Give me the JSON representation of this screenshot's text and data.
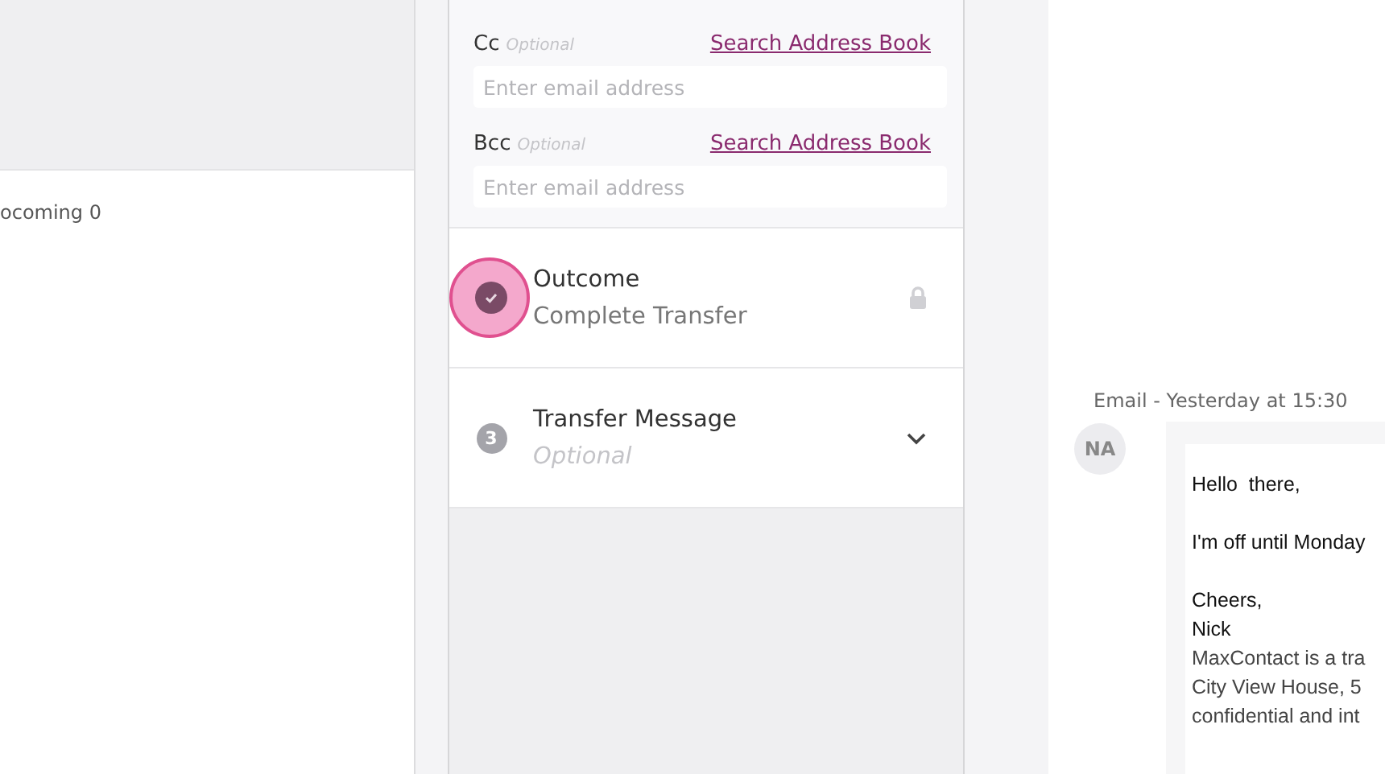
{
  "left_panel": {
    "status_text": "ocoming 0"
  },
  "recipients": [
    {
      "label": "Cc",
      "hint": "Optional",
      "link": "Search Address Book",
      "placeholder": "Enter email address"
    },
    {
      "label": "Bcc",
      "hint": "Optional",
      "link": "Search Address Book",
      "placeholder": "Enter email address"
    }
  ],
  "steps": [
    {
      "kind": "done",
      "title": "Outcome",
      "subtitle": "Complete Transfer",
      "locked": true,
      "highlighted": true
    },
    {
      "kind": "numbered",
      "number": "3",
      "title": "Transfer Message",
      "subtitle": "Optional",
      "expanded": false,
      "highlighted": false
    }
  ],
  "conversation": {
    "meta": "Email - Yesterday at 15:30",
    "avatar": "NA",
    "paragraphs": [
      {
        "lines": [
          "Hello  there,"
        ]
      },
      {
        "lines": [
          "I'm off until Monday"
        ]
      },
      {
        "lines": [
          "Cheers,",
          "Nick"
        ]
      },
      {
        "kind": "signature",
        "lines": [
          "MaxContact is a tra",
          "City View House, 5",
          "confidential and int"
        ]
      }
    ]
  }
}
